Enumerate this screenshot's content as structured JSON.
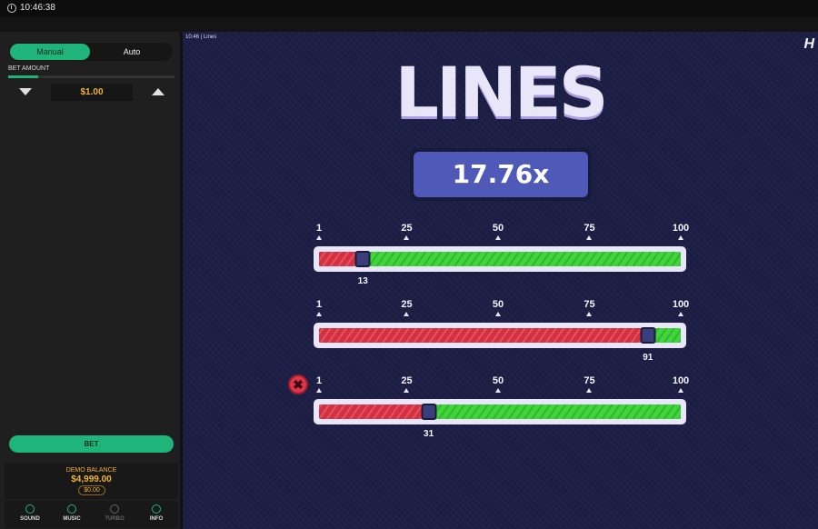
{
  "topbar": {
    "time": "10:46:38"
  },
  "panel": {
    "mode_tabs": [
      "Manual",
      "Auto"
    ],
    "active_mode": "Manual",
    "bet_amount_label": "BET AMOUNT",
    "bet_slider_fraction": 0.18,
    "bet_value": "$1.00",
    "bet_button": "BET",
    "balance_label": "DEMO BALANCE",
    "balance_value": "$4,999.00",
    "balance_sub": "$0.00",
    "bottom_items": [
      {
        "label": "SOUND",
        "icon": "sound-icon",
        "enabled": true
      },
      {
        "label": "MUSIC",
        "icon": "music-icon",
        "enabled": true
      },
      {
        "label": "TURBO",
        "icon": "turbo-icon",
        "enabled": false
      },
      {
        "label": "INFO",
        "icon": "info-icon",
        "enabled": true
      }
    ]
  },
  "game": {
    "header": "10:46 | Lines",
    "logo": "H",
    "title": "LINES",
    "multiplier": "17.76x",
    "scale_labels": [
      "1",
      "25",
      "50",
      "75",
      "100"
    ],
    "scale_values": [
      1,
      25,
      50,
      75,
      100
    ],
    "lines": [
      {
        "value": 13,
        "label": "13",
        "failed": false
      },
      {
        "value": 91,
        "label": "91",
        "failed": false
      },
      {
        "value": 31,
        "label": "31",
        "failed": true
      }
    ]
  },
  "colors": {
    "accent_green": "#1fb57a",
    "gold": "#f2b233",
    "slider_red": "#d63040",
    "slider_green": "#3fd63a",
    "game_bg": "#1c1e45",
    "multiplier_box": "#4e59b8"
  }
}
